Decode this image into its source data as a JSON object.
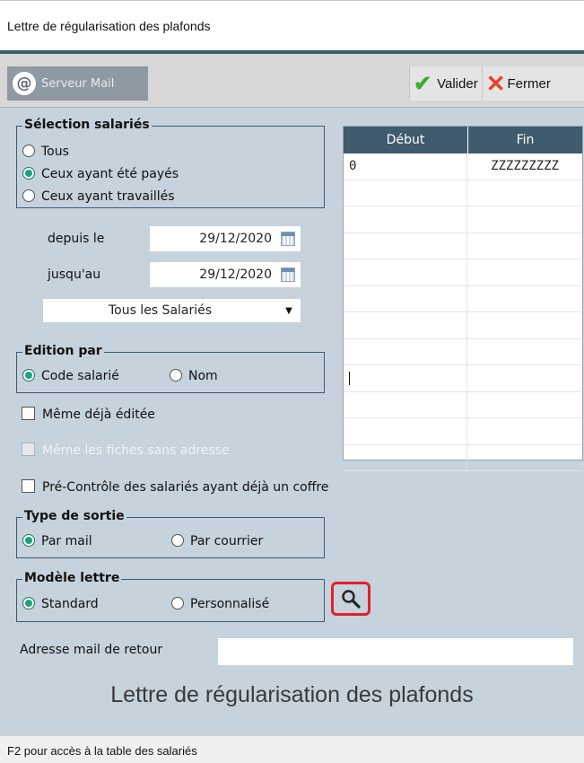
{
  "window": {
    "title": "Lettre de régularisation des plafonds"
  },
  "toolbar": {
    "mail_server": "Serveur Mail",
    "validate": "Valider",
    "close": "Fermer"
  },
  "employee_selection": {
    "title": "Sélection salariés",
    "options": [
      "Tous",
      "Ceux ayant été payés",
      "Ceux ayant travaillés"
    ],
    "selected": "Ceux ayant été payés"
  },
  "dates": {
    "from_label": "depuis le",
    "from_value": "29/12/2020",
    "to_label": "jusqu'au",
    "to_value": "29/12/2020"
  },
  "employee_filter": {
    "selected": "Tous les Salariés"
  },
  "range_table": {
    "headers": [
      "Début",
      "Fin"
    ],
    "rows": [
      [
        "0",
        "ZZZZZZZZZ"
      ]
    ]
  },
  "edition_by": {
    "title": "Edition par",
    "options": [
      "Code salarié",
      "Nom"
    ],
    "selected": "Code salarié"
  },
  "checkboxes": {
    "already_edited": "Même déjà éditée",
    "without_address": "Même les fiches sans adresse",
    "pre_control": "Pré-Contrôle des salariés ayant déjà un coffre"
  },
  "output_type": {
    "title": "Type de sortie",
    "options": [
      "Par mail",
      "Par courrier"
    ],
    "selected": "Par mail"
  },
  "letter_model": {
    "title": "Modèle lettre",
    "options": [
      "Standard",
      "Personnalisé"
    ],
    "selected": "Standard"
  },
  "return_email": {
    "label": "Adresse mail de retour",
    "value": ""
  },
  "main_title": "Lettre de régularisation des plafonds",
  "status_bar": "F2 pour accès à la table des salariés",
  "colors": {
    "accent": "#3f5b6e",
    "panel": "#c6d2dc",
    "highlight": "#e2202a"
  }
}
